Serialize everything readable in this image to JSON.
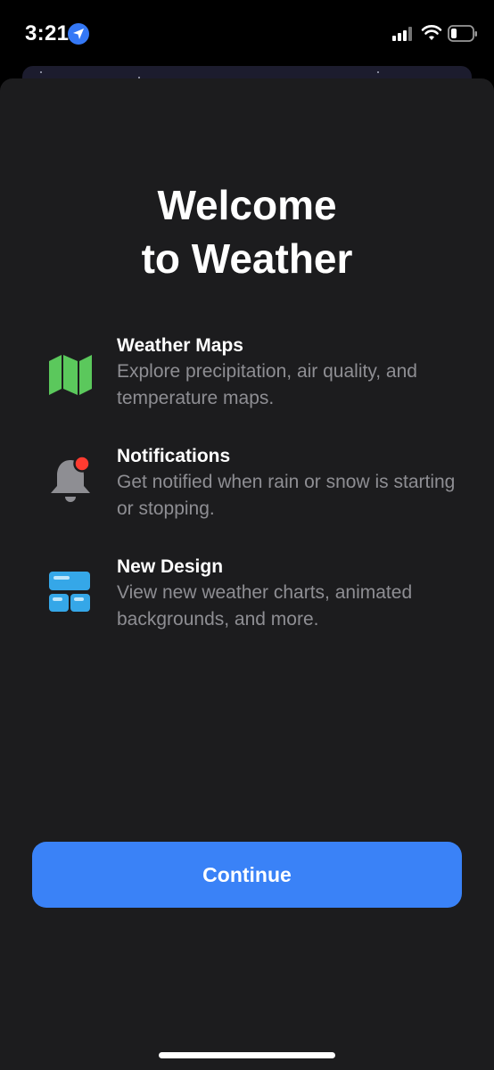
{
  "status_bar": {
    "time": "3:21",
    "icons": [
      "location-arrow-icon",
      "signal-bars-icon",
      "wifi-icon",
      "battery-low-icon"
    ]
  },
  "welcome": {
    "title_line1": "Welcome",
    "title_line2": "to Weather"
  },
  "features": [
    {
      "icon": "map-icon",
      "icon_color": "#5bc85c",
      "title": "Weather Maps",
      "description": "Explore precipitation, air quality, and temperature maps."
    },
    {
      "icon": "bell-notification-icon",
      "icon_color": "#8e8e93",
      "badge_color": "#ff3b30",
      "title": "Notifications",
      "description": "Get notified when rain or snow is starting or stopping."
    },
    {
      "icon": "layout-blocks-icon",
      "icon_color": "#35a7e8",
      "title": "New Design",
      "description": "View new weather charts, animated backgrounds, and more."
    }
  ],
  "actions": {
    "continue_label": "Continue"
  },
  "colors": {
    "background": "#1c1c1e",
    "accent": "#3a82f7",
    "secondary_text": "#8e8e93"
  }
}
